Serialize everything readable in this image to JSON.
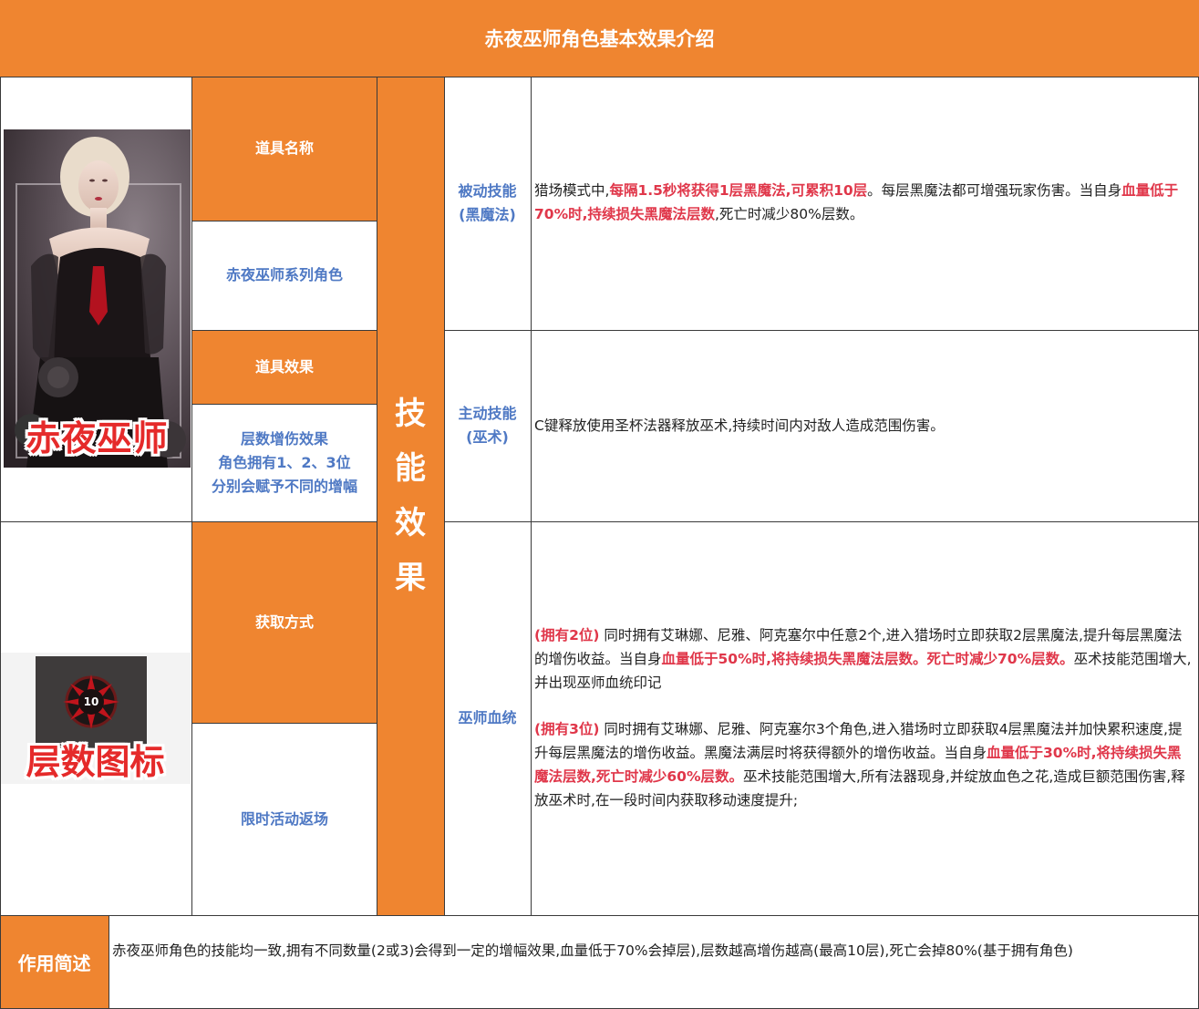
{
  "title": "赤夜巫师角色基本效果介绍",
  "character_banner": "赤夜巫师",
  "stack_icon": {
    "number": "10",
    "label": "层数图标"
  },
  "labels": {
    "item_name": "道具名称",
    "item_name_value": "赤夜巫师系列角色",
    "item_effect": "道具效果",
    "item_effect_value": [
      "层数增伤效果",
      "角色拥有1、2、3位",
      "分别会赋予不同的增幅"
    ],
    "obtain": "获取方式",
    "obtain_value": "限时活动返场",
    "skill_effect": "技能效果"
  },
  "skills": {
    "passive": {
      "name": [
        "被动技能",
        "(黑魔法)"
      ],
      "desc": [
        {
          "t": "猎场模式中,",
          "hl": false
        },
        {
          "t": "每隔1.5秒将获得1层黑魔法,可累积10层",
          "hl": true
        },
        {
          "t": "。每层黑魔法都可增强玩家伤害。当自身",
          "hl": false
        },
        {
          "t": "血量低于70%时,持续损失黑魔法层数",
          "hl": true
        },
        {
          "t": ",死亡时减少80%层数。",
          "hl": false
        }
      ]
    },
    "active": {
      "name": [
        "主动技能",
        "(巫术)"
      ],
      "desc": "C键释放使用圣杯法器释放巫术,持续时间内对敌人造成范围伤害。"
    },
    "bloodline": {
      "name": "巫师血统",
      "desc2": [
        {
          "t": "(拥有2位)",
          "hl": true
        },
        {
          "t": " 同时拥有艾琳娜、尼雅、阿克塞尔中任意2个,进入猎场时立即获取2层黑魔法,提升每层黑魔法的增伤收益。当自身",
          "hl": false
        },
        {
          "t": "血量低于50%时,将持续损失黑魔法层数。死亡时减少70%层数。",
          "hl": true
        },
        {
          "t": "巫术技能范围增大,并出现巫师血统印记",
          "hl": false
        }
      ],
      "desc3": [
        {
          "t": "(拥有3位)",
          "hl": true
        },
        {
          "t": " 同时拥有艾琳娜、尼雅、阿克塞尔3个角色,进入猎场时立即获取4层黑魔法并加快累积速度,提升每层黑魔法的增伤收益。黑魔法满层时将获得额外的增伤收益。当自身",
          "hl": false
        },
        {
          "t": "血量低于30%时,将持续损失黑魔法层数,死亡时减少60%层数。",
          "hl": true
        },
        {
          "t": "巫术技能范围增大,所有法器现身,并绽放血色之花,造成巨额范围伤害,释放巫术时,在一段时间内获取移动速度提升;",
          "hl": false
        }
      ]
    }
  },
  "summary": {
    "label": "作用简述",
    "text": "赤夜巫师角色的技能均一致,拥有不同数量(2或3)会得到一定的增幅效果,血量低于70%会掉层),层数越高增伤越高(最高10层),死亡会掉80%(基于拥有角色)"
  },
  "colors": {
    "accent": "#ef8530",
    "label_blue": "#4f79c4",
    "highlight_red": "#e0374a"
  }
}
